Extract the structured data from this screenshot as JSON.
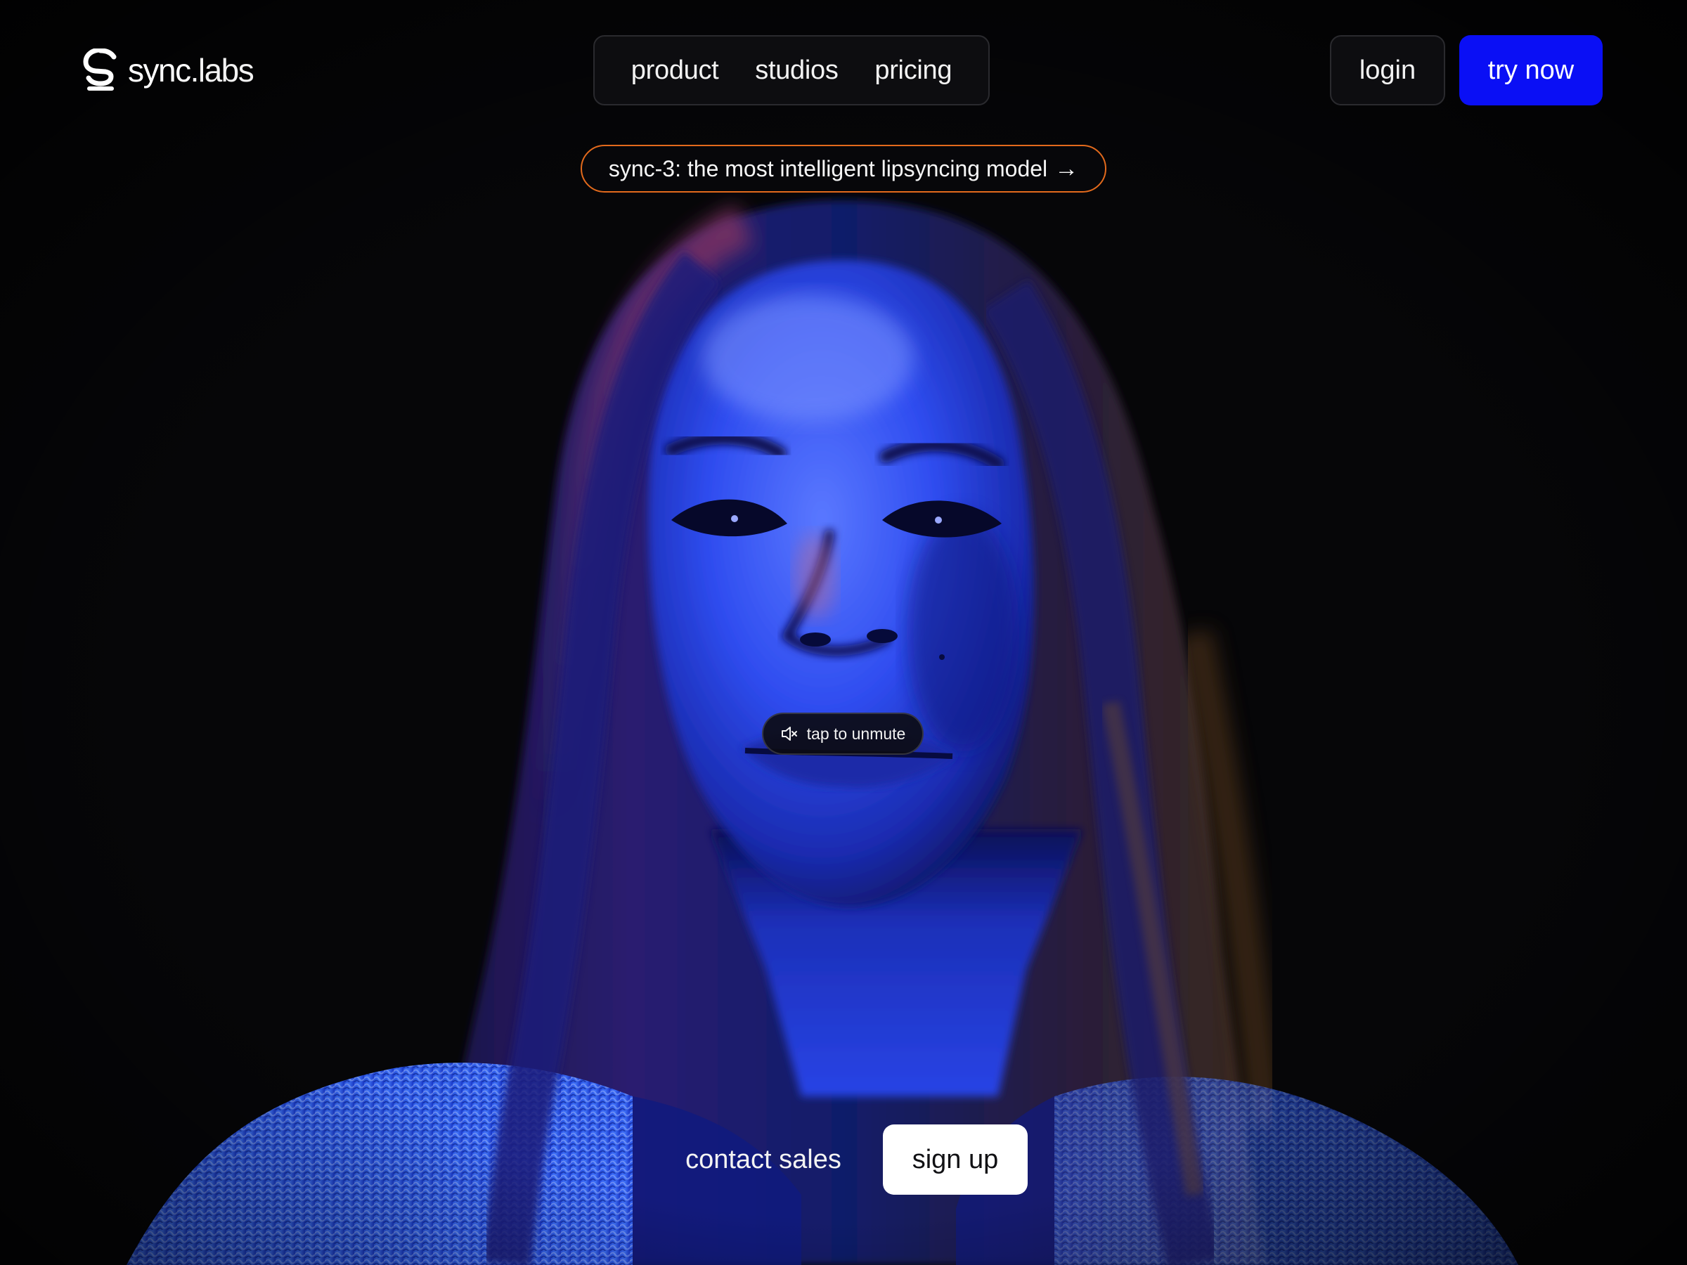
{
  "brand": {
    "name": "sync",
    "suffix": ".labs",
    "icon": "sync-labs-logo-icon"
  },
  "nav": {
    "items": [
      {
        "label": "product"
      },
      {
        "label": "studios"
      },
      {
        "label": "pricing"
      }
    ]
  },
  "header_actions": {
    "login_label": "login",
    "try_label": "try now"
  },
  "announcement": {
    "text": "sync-3: the most intelligent lipsyncing model",
    "arrow": "→",
    "border_color": "#e36a1c"
  },
  "video": {
    "unmute_label": "tap to unmute",
    "unmute_icon": "speaker-muted-icon"
  },
  "cta": {
    "contact_label": "contact sales",
    "signup_label": "sign up"
  },
  "colors": {
    "background": "#060608",
    "accent": "#0a0ff5",
    "announcement_border": "#e36a1c",
    "signup_bg": "#ffffff"
  }
}
